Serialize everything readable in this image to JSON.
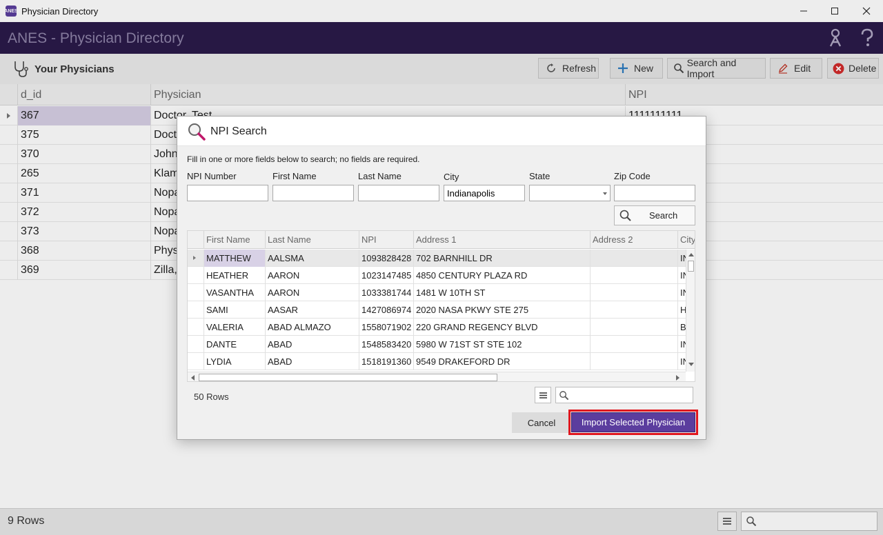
{
  "window": {
    "title": "Physician Directory",
    "app_icon_text": "ANES"
  },
  "header": {
    "app_title": "ANES - Physician Directory"
  },
  "toolbar": {
    "heading": "Your Physicians",
    "refresh_label": "Refresh",
    "new_label": "New",
    "search_import_label": "Search and Import",
    "edit_label": "Edit",
    "delete_label": "Delete"
  },
  "main_grid": {
    "columns": [
      "d_id",
      "Physician",
      "NPI"
    ],
    "rows": [
      {
        "d_id": "367",
        "physician": "Doctor, Test",
        "npi": "1111111111"
      },
      {
        "d_id": "375",
        "physician": "Doct",
        "npi": ""
      },
      {
        "d_id": "370",
        "physician": "John",
        "npi": ""
      },
      {
        "d_id": "265",
        "physician": "Klam",
        "npi": ""
      },
      {
        "d_id": "371",
        "physician": "Nopa",
        "npi": ""
      },
      {
        "d_id": "372",
        "physician": "Nopa",
        "npi": ""
      },
      {
        "d_id": "373",
        "physician": "Nopa",
        "npi": ""
      },
      {
        "d_id": "368",
        "physician": "Phys",
        "npi": ""
      },
      {
        "d_id": "369",
        "physician": "Zilla,",
        "npi": ""
      }
    ]
  },
  "statusbar": {
    "rows_label": "9 Rows",
    "search_placeholder": ""
  },
  "modal": {
    "title": "NPI Search",
    "hint": "Fill in one or more fields below to search; no fields are required.",
    "fields": {
      "npi_label": "NPI Number",
      "npi_value": "",
      "first_label": "First Name",
      "first_value": "",
      "last_label": "Last Name",
      "last_value": "",
      "city_label": "City",
      "city_value": "Indianapolis",
      "state_label": "State",
      "state_value": "",
      "zip_label": "Zip Code",
      "zip_value": ""
    },
    "search_label": "Search",
    "results": {
      "columns": [
        "First Name",
        "Last Name",
        "NPI",
        "Address 1",
        "Address 2",
        "City"
      ],
      "rows": [
        {
          "first": "MATTHEW",
          "last": "AALSMA",
          "npi": "1093828428",
          "addr1": "702 BARNHILL DR",
          "addr2": "",
          "city": "IN"
        },
        {
          "first": "HEATHER",
          "last": "AARON",
          "npi": "1023147485",
          "addr1": "4850 CENTURY PLAZA RD",
          "addr2": "",
          "city": "IN"
        },
        {
          "first": "VASANTHA",
          "last": "AARON",
          "npi": "1033381744",
          "addr1": "1481 W 10TH ST",
          "addr2": "",
          "city": "IN"
        },
        {
          "first": "SAMI",
          "last": "AASAR",
          "npi": "1427086974",
          "addr1": "2020 NASA PKWY STE 275",
          "addr2": "",
          "city": "H"
        },
        {
          "first": "VALERIA",
          "last": "ABAD ALMAZO",
          "npi": "1558071902",
          "addr1": "220 GRAND REGENCY BLVD",
          "addr2": "",
          "city": "B"
        },
        {
          "first": "DANTE",
          "last": "ABAD",
          "npi": "1548583420",
          "addr1": "5980 W 71ST ST STE 102",
          "addr2": "",
          "city": "IN"
        },
        {
          "first": "LYDIA",
          "last": "ABAD",
          "npi": "1518191360",
          "addr1": "9549 DRAKEFORD DR",
          "addr2": "",
          "city": "IN"
        }
      ]
    },
    "rows_label": "50 Rows",
    "filter_placeholder": "",
    "cancel_label": "Cancel",
    "import_label": "Import Selected Physician"
  },
  "colors": {
    "header_bg": "#2b1a4a",
    "accent": "#5b3d9e",
    "selection": "#d7cfe5",
    "highlight_border": "#e0171f"
  },
  "icons": [
    "app-icon",
    "minimize-icon",
    "maximize-icon",
    "close-icon",
    "keys-icon",
    "help-icon",
    "stethoscope-icon",
    "refresh-icon",
    "plus-icon",
    "search-icon",
    "pencil-icon",
    "delete-icon",
    "menu-icon"
  ]
}
